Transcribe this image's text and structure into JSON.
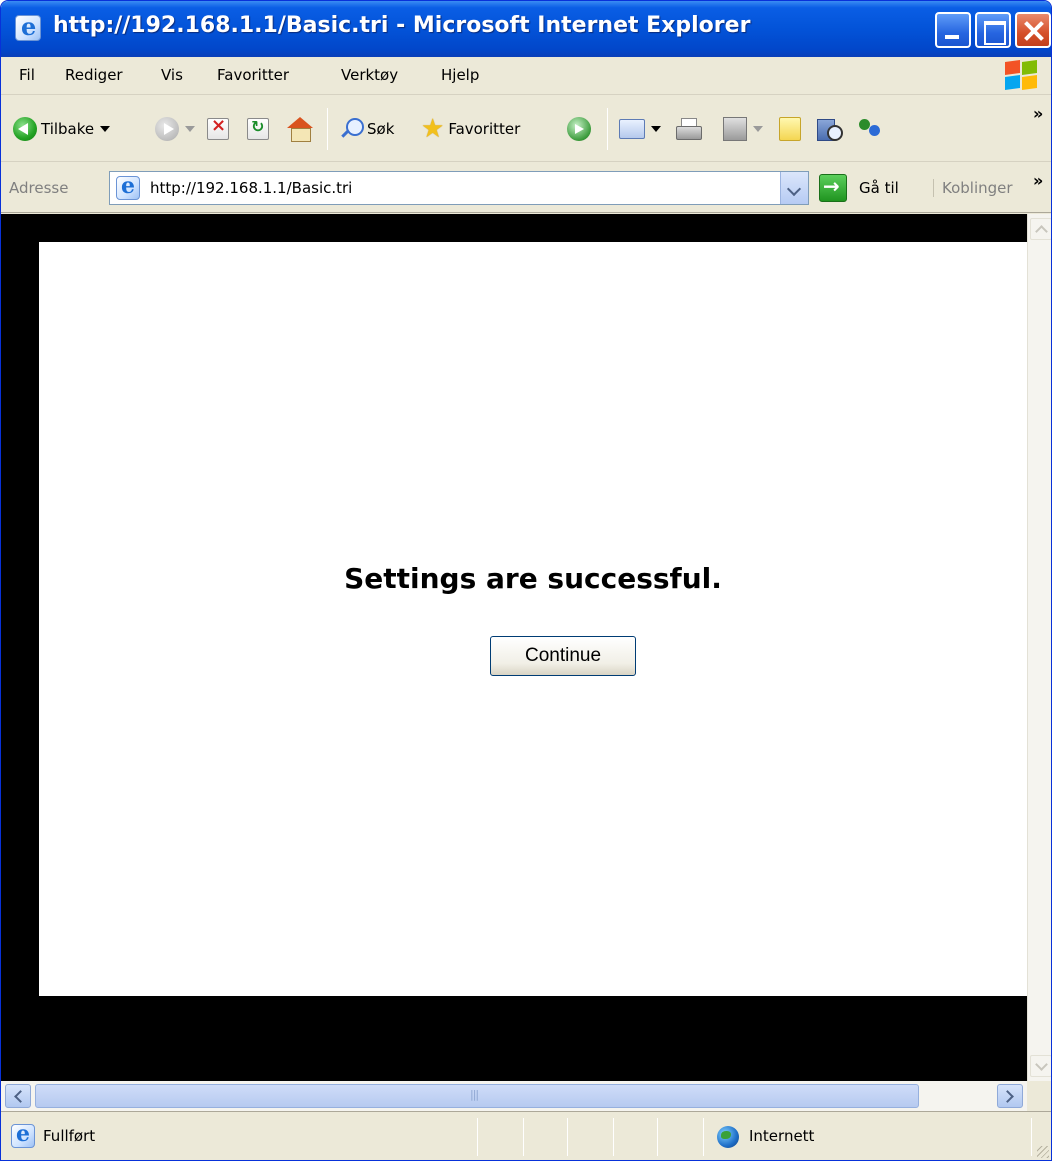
{
  "window": {
    "title": "http://192.168.1.1/Basic.tri - Microsoft Internet Explorer",
    "controls": {
      "minimize": "minimize",
      "maximize": "maximize",
      "close": "close"
    }
  },
  "menubar": {
    "items": [
      {
        "label": "Fil"
      },
      {
        "label": "Rediger"
      },
      {
        "label": "Vis"
      },
      {
        "label": "Favoritter"
      },
      {
        "label": "Verktøy"
      },
      {
        "label": "Hjelp"
      }
    ]
  },
  "toolbar": {
    "back_label": "Tilbake",
    "search_label": "Søk",
    "favorites_label": "Favoritter",
    "overflow": "»",
    "icons": [
      "back-icon",
      "forward-icon",
      "stop-icon",
      "refresh-icon",
      "home-icon",
      "search-icon",
      "favorites-star-icon",
      "media-icon",
      "mail-icon",
      "print-icon",
      "edit-icon",
      "note-icon",
      "research-icon",
      "messenger-icon"
    ]
  },
  "addressbar": {
    "label": "Adresse",
    "url": "http://192.168.1.1/Basic.tri",
    "go_label": "Gå til",
    "links_label": "Koblinger",
    "overflow": "»"
  },
  "page": {
    "message": "Settings are successful.",
    "continue_label": "Continue"
  },
  "statusbar": {
    "status": "Fullført",
    "zone": "Internett"
  },
  "colors": {
    "titlebar": "#0353d8",
    "chrome": "#ece9d8",
    "viewport_border": "#000000",
    "page_background": "#ffffff"
  }
}
